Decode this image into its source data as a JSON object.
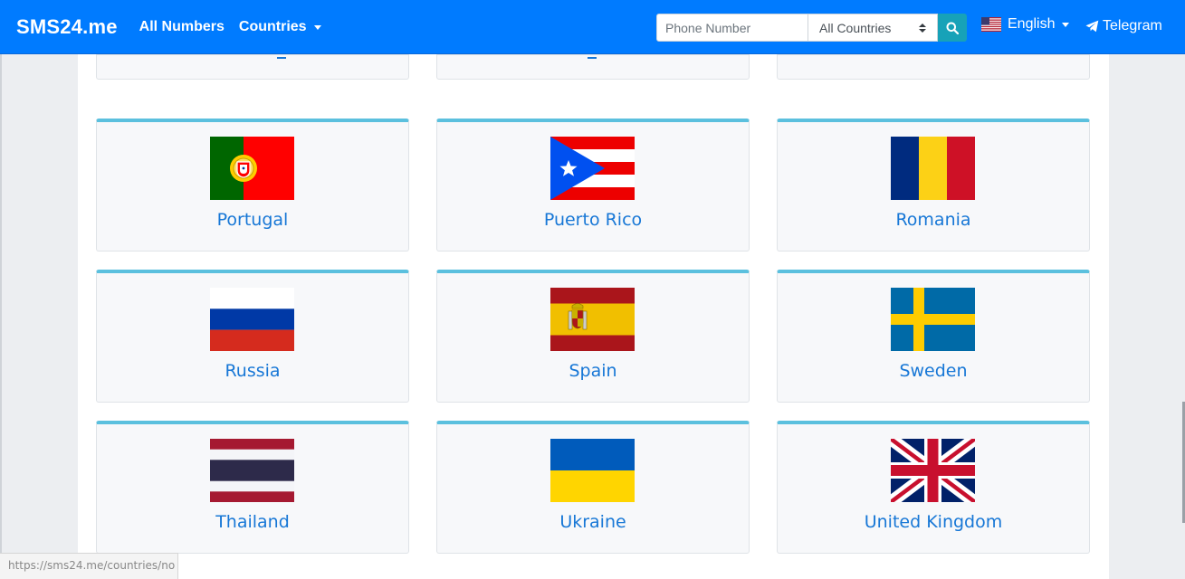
{
  "navbar": {
    "brand": "SMS24.me",
    "all_numbers": "All Numbers",
    "countries": "Countries",
    "search": {
      "placeholder": "Phone Number",
      "select_value": "All Countries"
    },
    "language": "English",
    "telegram": "Telegram"
  },
  "colors": {
    "navbar": "#007bff",
    "card_accent": "#5bc0de",
    "country_link": "#1777d6",
    "search_button": "#17a2b8"
  },
  "countries": [
    {
      "name": "Portugal",
      "flag": "portugal-flag"
    },
    {
      "name": "Puerto Rico",
      "flag": "puerto-rico-flag"
    },
    {
      "name": "Romania",
      "flag": "romania-flag"
    },
    {
      "name": "Russia",
      "flag": "russia-flag"
    },
    {
      "name": "Spain",
      "flag": "spain-flag"
    },
    {
      "name": "Sweden",
      "flag": "sweden-flag"
    },
    {
      "name": "Thailand",
      "flag": "thailand-flag"
    },
    {
      "name": "Ukraine",
      "flag": "ukraine-flag"
    },
    {
      "name": "United Kingdom",
      "flag": "united-kingdom-flag"
    }
  ],
  "status_bar": {
    "url": "https://sms24.me/countries/no"
  }
}
